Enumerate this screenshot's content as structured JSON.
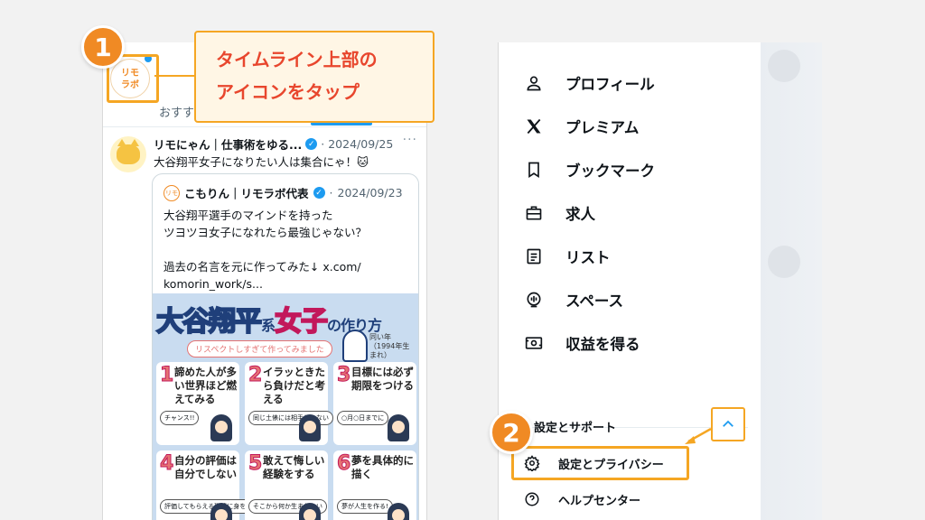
{
  "annotations": {
    "step1": "1",
    "step2": "2",
    "callout_line1": "タイムライン上部の",
    "callout_line2": "アイコンをタップ",
    "accent_color": "#f5a623",
    "callout_text_color": "#e8462d"
  },
  "timeline": {
    "account_logo": "リモ\nラボ",
    "tab_label": "おすす",
    "tweet": {
      "name": "リモにゃん｜仕事術をゆる...",
      "date": "2024/09/25",
      "text": "大谷翔平女子になりたい人は集合にゃ！🐱",
      "more": "···"
    },
    "quote": {
      "avatar": "リモ",
      "name": "こもりん｜リモラボ代表",
      "date": "2024/09/23",
      "lines": [
        "大谷翔平選手のマインドを持った",
        "ツヨツヨ女子になれたら最強じゃない？",
        "",
        "過去の名言を元に作ってみた↓ x.com/",
        "komorin_work/s..."
      ]
    },
    "infographic": {
      "title_main": "大谷翔平",
      "title_kei": "系",
      "title_joshi": "女子",
      "title_suffix": "の作り方",
      "subtitle": "リスペクトしすぎて作ってみました",
      "note": "同い年（1994年生まれ）",
      "cells": [
        {
          "num": "1",
          "text": "諦めた人が多い世界ほど燃えてみる",
          "bubble": "チャンス!!"
        },
        {
          "num": "2",
          "text": "イラッときたら負けだと考える",
          "bubble": "同じ土俵には相手しかない"
        },
        {
          "num": "3",
          "text": "目標には必ず期限をつける",
          "bubble": "○月○日までに"
        },
        {
          "num": "4",
          "text": "自分の評価は自分でしない",
          "bubble": "評価してもらえる環境に身を置け!"
        },
        {
          "num": "5",
          "text": "敢えて悔しい経験をする",
          "bubble": "そこから何か生まれない"
        },
        {
          "num": "6",
          "text": "夢を具体的に描く",
          "bubble": "夢が人生を作る!"
        }
      ]
    }
  },
  "menu": {
    "items": [
      {
        "label": "プロフィール",
        "icon": "person-icon"
      },
      {
        "label": "プレミアム",
        "icon": "x-logo-icon"
      },
      {
        "label": "ブックマーク",
        "icon": "bookmark-icon"
      },
      {
        "label": "求人",
        "icon": "briefcase-icon"
      },
      {
        "label": "リスト",
        "icon": "list-icon"
      },
      {
        "label": "スペース",
        "icon": "spaces-icon"
      },
      {
        "label": "収益を得る",
        "icon": "money-icon"
      }
    ],
    "section_title": "設定とサポート",
    "settings_label": "設定とプライバシー",
    "help_label": "ヘルプセンター"
  }
}
